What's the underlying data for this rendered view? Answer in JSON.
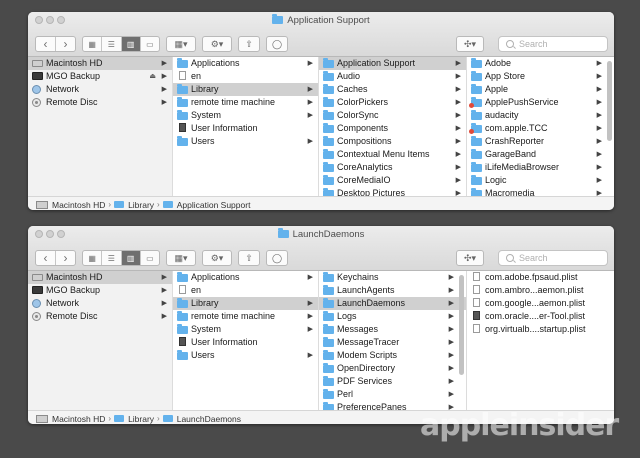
{
  "windows": [
    {
      "title": "Application Support",
      "search_placeholder": "Search",
      "sidebar": [
        "Macintosh HD",
        "MGO Backup",
        "Network",
        "Remote Disc"
      ],
      "col1": [
        "Applications",
        "en",
        "Library",
        "remote time machine",
        "System",
        "User Information",
        "Users"
      ],
      "col2": [
        "Application Support",
        "Audio",
        "Caches",
        "ColorPickers",
        "ColorSync",
        "Components",
        "Compositions",
        "Contextual Menu Items",
        "CoreAnalytics",
        "CoreMediaIO",
        "Desktop Pictures"
      ],
      "col3": [
        "Adobe",
        "App Store",
        "Apple",
        "ApplePushService",
        "audacity",
        "com.apple.TCC",
        "CrashReporter",
        "GarageBand",
        "iLifeMediaBrowser",
        "Logic",
        "Macromedia"
      ],
      "path": [
        "Macintosh HD",
        "Library",
        "Application Support"
      ]
    },
    {
      "title": "LaunchDaemons",
      "search_placeholder": "Search",
      "sidebar": [
        "Macintosh HD",
        "MGO Backup",
        "Network",
        "Remote Disc"
      ],
      "col1": [
        "Applications",
        "en",
        "Library",
        "remote time machine",
        "System",
        "User Information",
        "Users"
      ],
      "col2": [
        "Keychains",
        "LaunchAgents",
        "LaunchDaemons",
        "Logs",
        "Messages",
        "MessageTracer",
        "Modem Scripts",
        "OpenDirectory",
        "PDF Services",
        "Perl",
        "PreferencePanes"
      ],
      "col3": [
        "com.adobe.fpsaud.plist",
        "com.ambro...aemon.plist",
        "com.google...aemon.plist",
        "com.oracle....er-Tool.plist",
        "org.virtualb....startup.plist"
      ],
      "path": [
        "Macintosh HD",
        "Library",
        "LaunchDaemons"
      ]
    }
  ],
  "toolbar": {
    "back": "‹",
    "forward": "›",
    "share": "⇧",
    "tag": "◯",
    "dropbox": "✣"
  },
  "watermark": "appleinsider"
}
